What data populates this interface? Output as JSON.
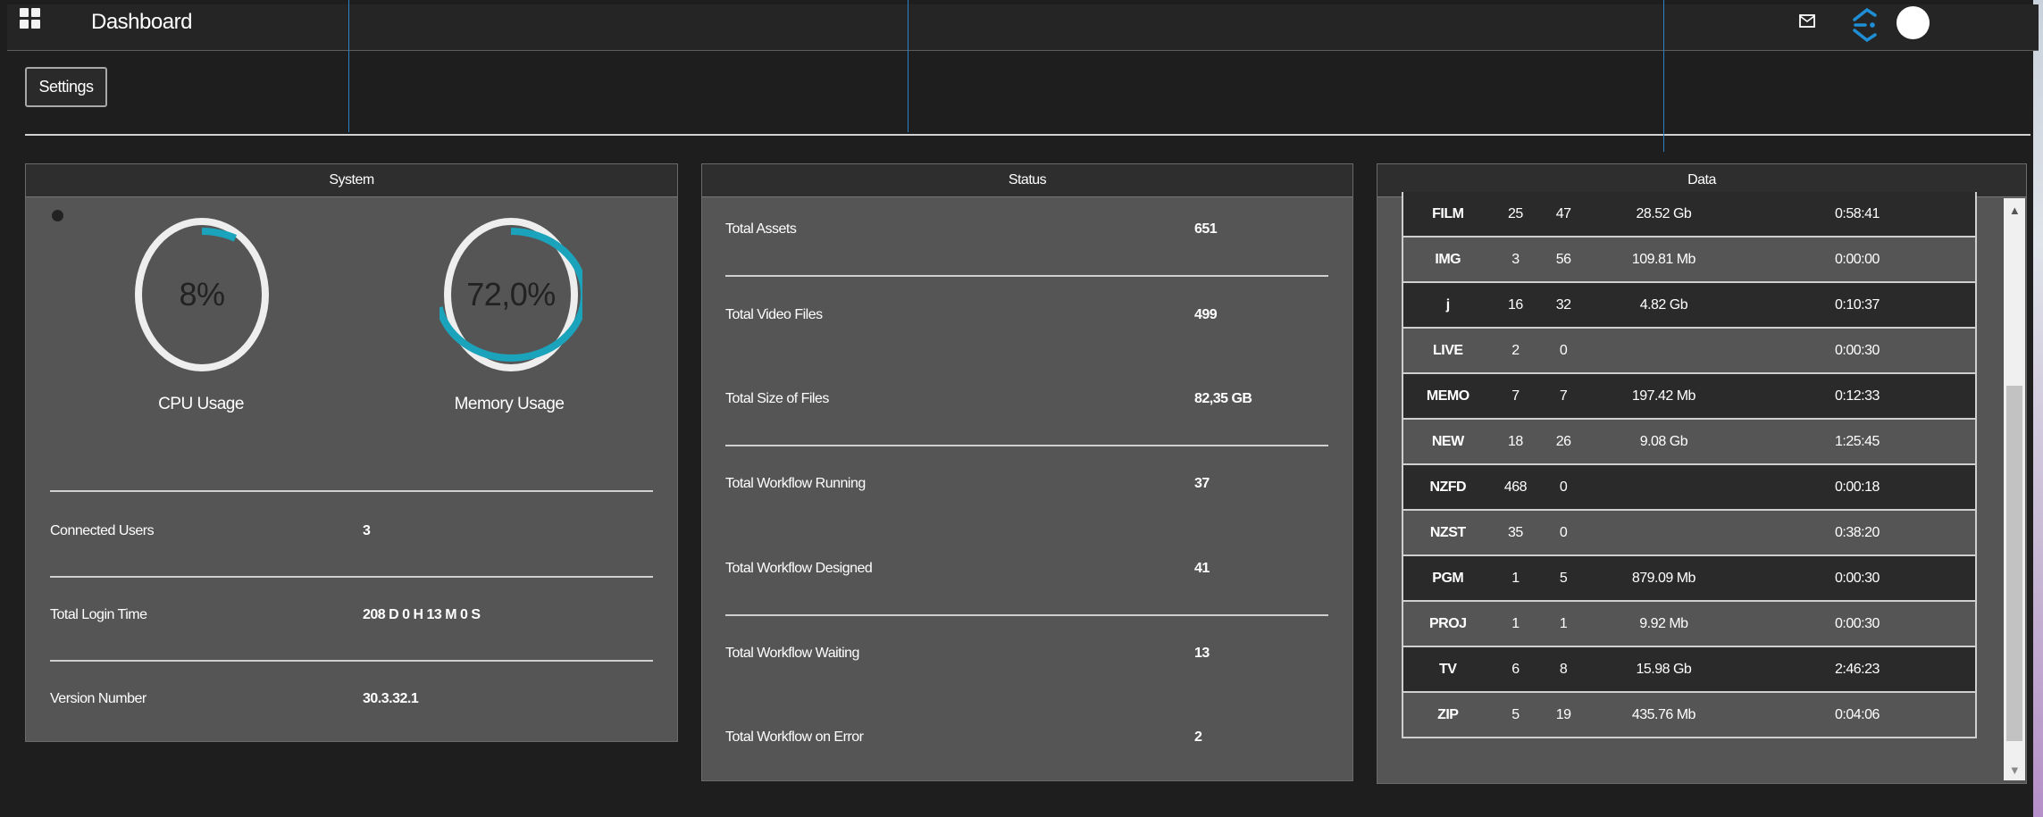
{
  "header": {
    "title": "Dashboard",
    "icons": [
      "grid-icon",
      "mail-icon",
      "brand-icon",
      "avatar"
    ]
  },
  "toolbar": {
    "settings_label": "Settings"
  },
  "system": {
    "title": "System",
    "cpu": {
      "value": "8%",
      "fraction": 0.08,
      "label": "CPU Usage"
    },
    "memory": {
      "value": "72,0%",
      "fraction": 0.72,
      "label": "Memory Usage"
    },
    "rows": [
      {
        "label": "Connected Users",
        "value": "3"
      },
      {
        "label": "Total Login Time",
        "value": "208 D 0 H 13 M 0 S"
      },
      {
        "label": "Version Number",
        "value": "30.3.32.1"
      }
    ]
  },
  "status": {
    "title": "Status",
    "rows": [
      {
        "label": "Total Assets",
        "value": "651"
      },
      {
        "label": "Total Video Files",
        "value": "499"
      },
      {
        "label": "Total Size of Files",
        "value": "82,35 GB"
      },
      {
        "label": "Total Workflow Running",
        "value": "37"
      },
      {
        "label": "Total Workflow Designed",
        "value": "41"
      },
      {
        "label": "Total Workflow Waiting",
        "value": "13"
      },
      {
        "label": "Total Workflow on Error",
        "value": "2"
      }
    ]
  },
  "data_panel": {
    "title": "Data",
    "rows": [
      [
        "FILM",
        "25",
        "47",
        "28.52 Gb",
        "0:58:41"
      ],
      [
        "IMG",
        "3",
        "56",
        "109.81 Mb",
        "0:00:00"
      ],
      [
        "j",
        "16",
        "32",
        "4.82 Gb",
        "0:10:37"
      ],
      [
        "LIVE",
        "2",
        "0",
        "",
        "0:00:30"
      ],
      [
        "MEMO",
        "7",
        "7",
        "197.42 Mb",
        "0:12:33"
      ],
      [
        "NEW",
        "18",
        "26",
        "9.08 Gb",
        "1:25:45"
      ],
      [
        "NZFD",
        "468",
        "0",
        "",
        "0:00:18"
      ],
      [
        "NZST",
        "35",
        "0",
        "",
        "0:38:20"
      ],
      [
        "PGM",
        "1",
        "5",
        "879.09 Mb",
        "0:00:30"
      ],
      [
        "PROJ",
        "1",
        "1",
        "9.92 Mb",
        "0:00:30"
      ],
      [
        "TV",
        "6",
        "8",
        "15.98 Gb",
        "2:46:23"
      ],
      [
        "ZIP",
        "5",
        "19",
        "435.76 Mb",
        "0:04:06"
      ]
    ]
  },
  "colors": {
    "accent": "#1aa3bb",
    "gauge_track": "#eeeeee",
    "panel_bg": "#555555",
    "page_bg": "#1e1e1e"
  }
}
